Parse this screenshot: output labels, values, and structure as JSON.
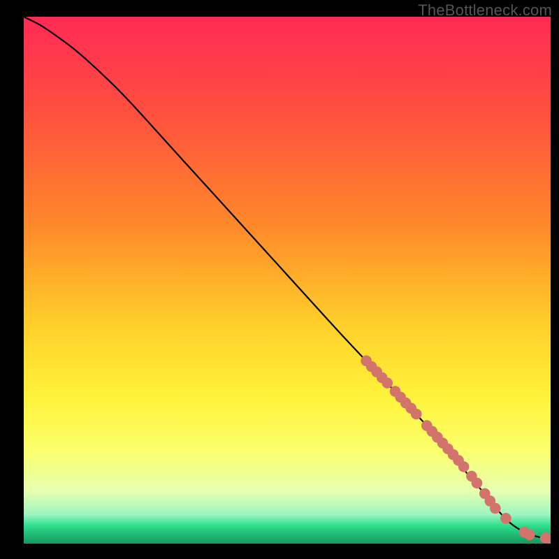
{
  "watermark": "TheBottleneck.com",
  "colors": {
    "page_bg": "#000000",
    "gradient_stops": [
      {
        "offset": 0.0,
        "color": "#ff2a55"
      },
      {
        "offset": 0.18,
        "color": "#ff4f3f"
      },
      {
        "offset": 0.4,
        "color": "#ff8a2a"
      },
      {
        "offset": 0.58,
        "color": "#ffce2a"
      },
      {
        "offset": 0.72,
        "color": "#fff23a"
      },
      {
        "offset": 0.82,
        "color": "#fbff6a"
      },
      {
        "offset": 0.9,
        "color": "#e7ffb0"
      },
      {
        "offset": 0.945,
        "color": "#9cf5c0"
      },
      {
        "offset": 0.965,
        "color": "#2fe08d"
      },
      {
        "offset": 0.985,
        "color": "#1fb572"
      },
      {
        "offset": 1.0,
        "color": "#17985f"
      }
    ],
    "curve": "#000000",
    "dots": "#d2736c"
  },
  "chart_data": {
    "type": "line",
    "title": "",
    "xlabel": "",
    "ylabel": "",
    "xlim": [
      0,
      100
    ],
    "ylim": [
      0,
      100
    ],
    "curve": {
      "x": [
        0,
        3,
        6,
        10,
        15,
        20,
        30,
        40,
        50,
        60,
        68,
        75,
        80,
        84,
        87,
        89,
        92,
        95,
        98,
        100
      ],
      "y": [
        100,
        98.5,
        96.5,
        93.5,
        89,
        84,
        73,
        62,
        51,
        40,
        31.5,
        24,
        18.5,
        13.5,
        10,
        7.5,
        4.2,
        2.2,
        1.2,
        1.0
      ]
    },
    "series": [
      {
        "name": "highlight-dots",
        "x": [
          65.0,
          66.0,
          67.0,
          68.0,
          69.0,
          70.5,
          71.5,
          72.5,
          73.5,
          74.5,
          76.5,
          77.5,
          78.5,
          79.5,
          80.5,
          81.5,
          82.5,
          83.5,
          85.0,
          86.0,
          87.5,
          88.5,
          89.5,
          91.5,
          95.0,
          96.0,
          99.0,
          100.0
        ],
        "y": [
          34.7,
          33.6,
          32.6,
          31.5,
          30.5,
          28.9,
          27.8,
          26.7,
          25.7,
          24.6,
          22.4,
          21.3,
          20.2,
          19.1,
          18.0,
          16.9,
          15.8,
          14.6,
          12.8,
          11.5,
          9.5,
          8.1,
          6.7,
          4.8,
          2.2,
          1.7,
          1.1,
          1.0
        ]
      }
    ]
  }
}
